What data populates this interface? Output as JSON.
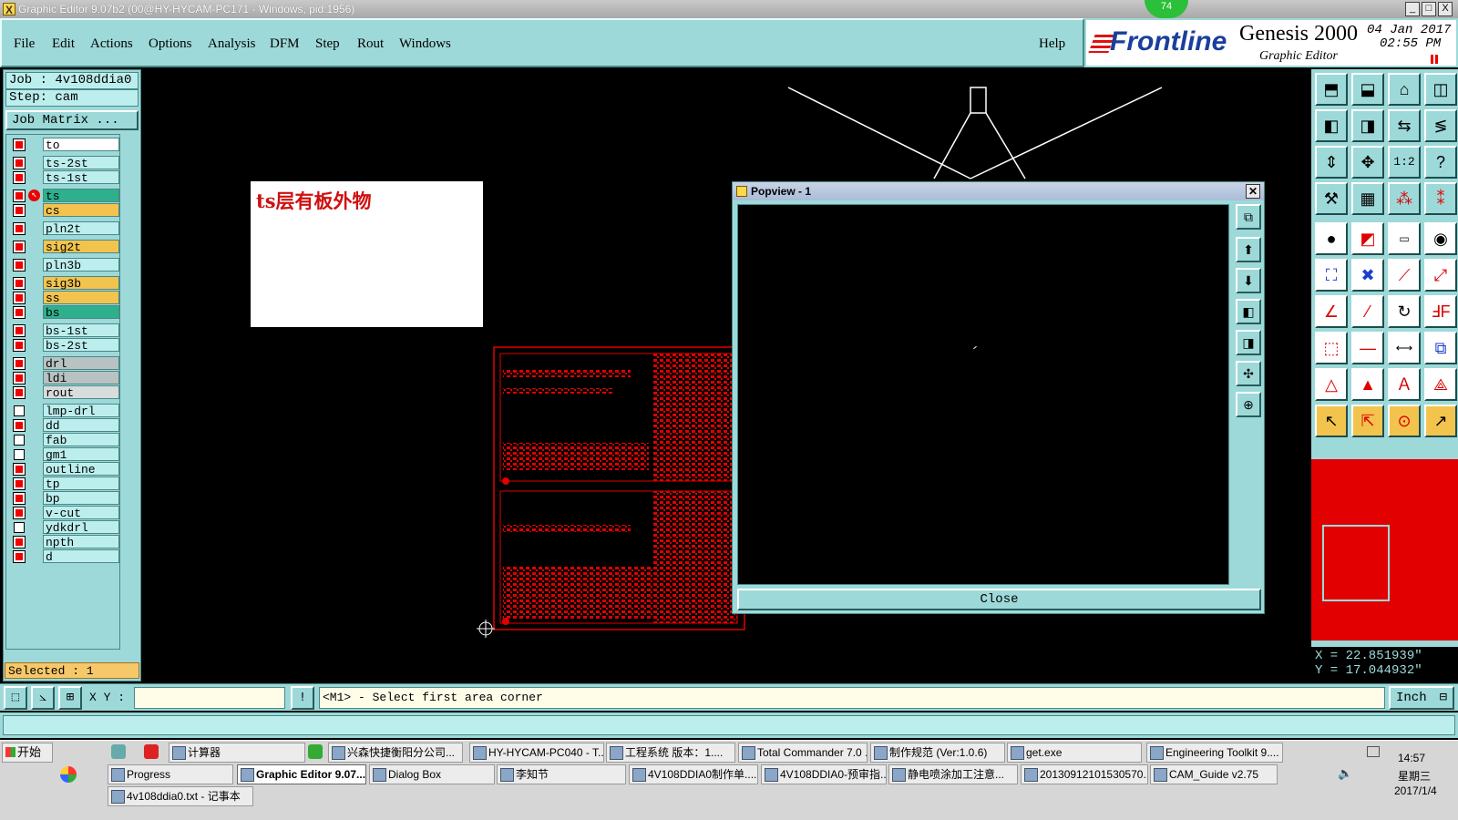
{
  "window": {
    "title": "Graphic Editor 9.07b2 (00@HY-HYCAM-PC171 - Windows, pid:1956)",
    "badge": "74",
    "controls": [
      "_",
      "□",
      "X"
    ]
  },
  "menubar": {
    "items": [
      "File",
      "Edit",
      "Actions",
      "Options",
      "Analysis",
      "DFM",
      "Step",
      "Rout",
      "Windows"
    ],
    "help": "Help"
  },
  "brand": {
    "logo": "Frontline",
    "product": "Genesis 2000",
    "subtitle": "Graphic Editor",
    "date": "04 Jan 2017",
    "time": "02:55 PM"
  },
  "job": {
    "job_label": "Job : 4v108ddia0",
    "step_label": "Step: cam",
    "matrix_button": "Job Matrix ..."
  },
  "layers": [
    {
      "name": "to",
      "color": "#ffffff",
      "box": "red"
    },
    {
      "name": "ts-2st",
      "color": "#bdeeee",
      "box": "red"
    },
    {
      "name": "ts-1st",
      "color": "#bdeeee",
      "box": "red"
    },
    {
      "name": "ts",
      "color": "#2fb08c",
      "box": "red",
      "mark": "✎⊕"
    },
    {
      "name": "cs",
      "color": "#f2c44e",
      "box": "red",
      "mark": "✎"
    },
    {
      "name": "pln2t",
      "color": "#bdeeee",
      "box": "red"
    },
    {
      "name": "sig2t",
      "color": "#f2c44e",
      "box": "red"
    },
    {
      "name": "pln3b",
      "color": "#bdeeee",
      "box": "red"
    },
    {
      "name": "sig3b",
      "color": "#f2c44e",
      "box": "red",
      "mark": "✎"
    },
    {
      "name": "ss",
      "color": "#f2c44e",
      "box": "red",
      "mark": "✎"
    },
    {
      "name": "bs",
      "color": "#2fb08c",
      "box": "red",
      "mark": "✎"
    },
    {
      "name": "bs-1st",
      "color": "#bdeeee",
      "box": "red"
    },
    {
      "name": "bs-2st",
      "color": "#bdeeee",
      "box": "red"
    },
    {
      "name": "drl",
      "color": "#b9c2c2",
      "box": "red"
    },
    {
      "name": "ldi",
      "color": "#b9c2c2",
      "box": "red"
    },
    {
      "name": "rout",
      "color": "#d8dcdc",
      "box": "red"
    },
    {
      "name": "lmp-drl",
      "color": "#bdeeee",
      "box": "white"
    },
    {
      "name": "dd",
      "color": "#bdeeee",
      "box": "red"
    },
    {
      "name": "fab",
      "color": "#bdeeee",
      "box": "white"
    },
    {
      "name": "gm1",
      "color": "#bdeeee",
      "box": "white",
      "mark": "✎"
    },
    {
      "name": "outline",
      "color": "#bdeeee",
      "box": "red"
    },
    {
      "name": "tp",
      "color": "#bdeeee",
      "box": "red"
    },
    {
      "name": "bp",
      "color": "#bdeeee",
      "box": "red"
    },
    {
      "name": "v-cut",
      "color": "#bdeeee",
      "box": "red"
    },
    {
      "name": "ydkdrl",
      "color": "#bdeeee",
      "box": "white"
    },
    {
      "name": "npth",
      "color": "#bdeeee",
      "box": "red"
    },
    {
      "name": "d",
      "color": "#bdeeee",
      "box": "red"
    }
  ],
  "selected": "Selected : 1",
  "canvas": {
    "note": "ts层有板外物"
  },
  "popview": {
    "title": "Popview - 1",
    "close_button": "Close",
    "tool_icons": [
      "zoom-window-icon",
      "zoom-in-icon",
      "zoom-out-icon",
      "pan-left-icon",
      "pan-right-icon",
      "fit-icon",
      "center-icon"
    ]
  },
  "coordinates": {
    "x": "X = 22.851939\"",
    "y": "Y = 17.044932\""
  },
  "command": {
    "xy_label": "X Y :",
    "xy_value": "",
    "prompt": "<M1> - Select first area corner",
    "unit": "Inch"
  },
  "taskbar": {
    "start": "开始",
    "row1": [
      "计算器",
      "兴森快捷衡阳分公司...",
      "HY-HYCAM-PC040 - T...",
      "工程系统  版本：1....",
      "Total Commander 7.0 ...",
      "制作规范 (Ver:1.0.6)",
      "get.exe",
      "Engineering Toolkit 9...."
    ],
    "row2": [
      "Progress",
      "Graphic Editor 9.07...",
      "Dialog Box",
      "李知节",
      "4V108DDIA0制作单....",
      "4V108DDIA0-预审指...",
      "静电喷涂加工注意...",
      "20130912101530570...",
      "CAM_Guide v2.75"
    ],
    "row3": [
      "4v108ddia0.txt - 记事本"
    ],
    "clock": "14:57",
    "weekday": "星期三",
    "date": "2017/1/4"
  },
  "colors": {
    "panel": "#9ed9d9",
    "canvas": "#000000",
    "board": "#e00000"
  }
}
